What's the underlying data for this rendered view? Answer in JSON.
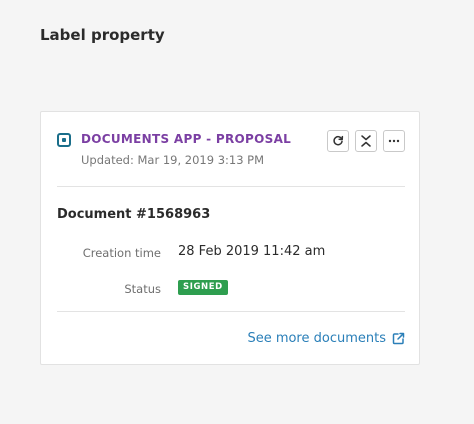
{
  "section": {
    "title": "Label property"
  },
  "card": {
    "app_icon": "document-app-icon",
    "app_title": "DOCUMENTS APP - PROPOSAL",
    "updated": "Updated: Mar 19, 2019 3:13 PM",
    "actions": [
      {
        "name": "refresh",
        "icon": "refresh-icon"
      },
      {
        "name": "collapse",
        "icon": "collapse-icon"
      },
      {
        "name": "more",
        "icon": "more-icon"
      }
    ],
    "document": {
      "title": "Document #1568963",
      "fields": [
        {
          "label": "Creation time",
          "value": "28 Feb 2019 11:42 am"
        },
        {
          "label": "Status",
          "value": "SIGNED"
        }
      ]
    },
    "footer": {
      "link_label": "See more documents",
      "link_icon": "external-link-icon"
    }
  },
  "colors": {
    "app_title": "#7b3fa3",
    "app_icon": "#1a6e8a",
    "status_signed": "#2e9e4f",
    "link": "#2a7fb8"
  }
}
